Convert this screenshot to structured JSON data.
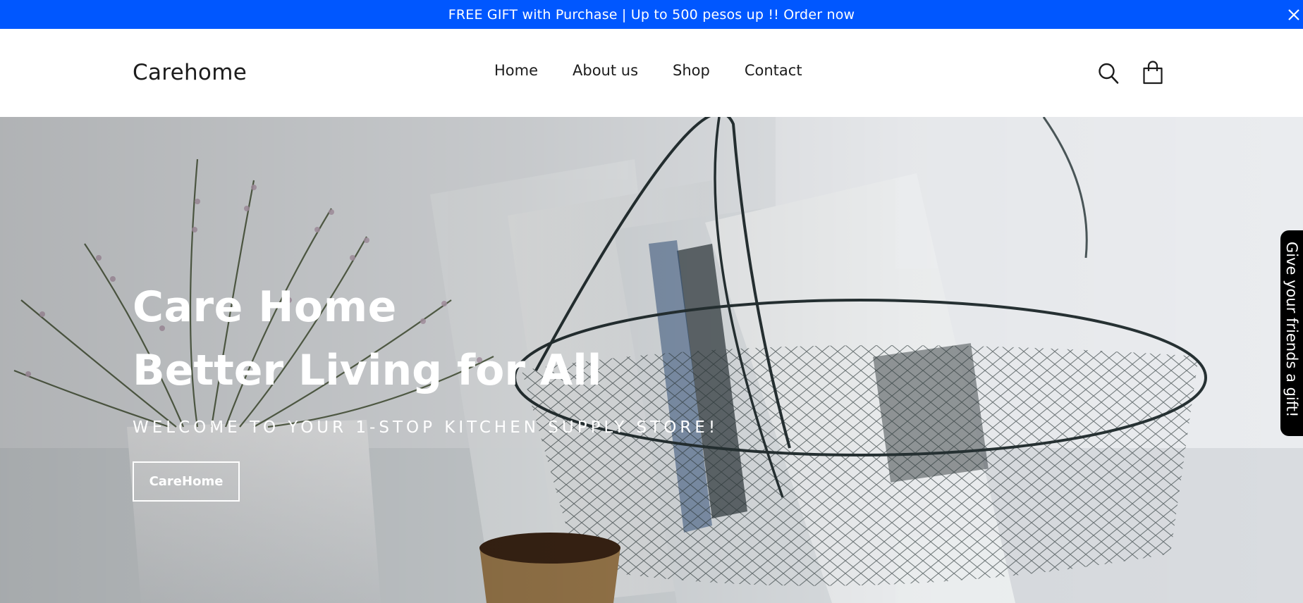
{
  "announcement": {
    "text": "FREE GIFT with Purchase | Up to 500 pesos up !! Order now",
    "close_icon": "close-icon",
    "background": "#0057ff"
  },
  "header": {
    "logo": "Carehome",
    "nav": [
      "Home",
      "About us",
      "Shop",
      "Contact"
    ],
    "icons": [
      "search-icon",
      "cart-icon"
    ]
  },
  "hero": {
    "title": "Care Home",
    "title2": "Better Living for All",
    "subtitle": "WELCOME TO YOUR 1-STOP KITCHEN SUPPLY STORE!",
    "button_label": "CareHome"
  },
  "gift_tab": {
    "label": "Give your friends a gift!"
  }
}
